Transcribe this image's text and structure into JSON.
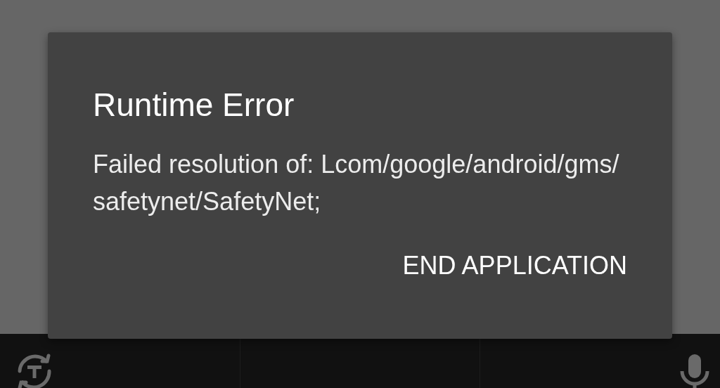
{
  "dialog": {
    "title": "Runtime Error",
    "message": "Failed resolution of: Lcom/google/android/gms/safetynet/SafetyNet;",
    "buttons": [
      "END APPLICATION"
    ]
  }
}
